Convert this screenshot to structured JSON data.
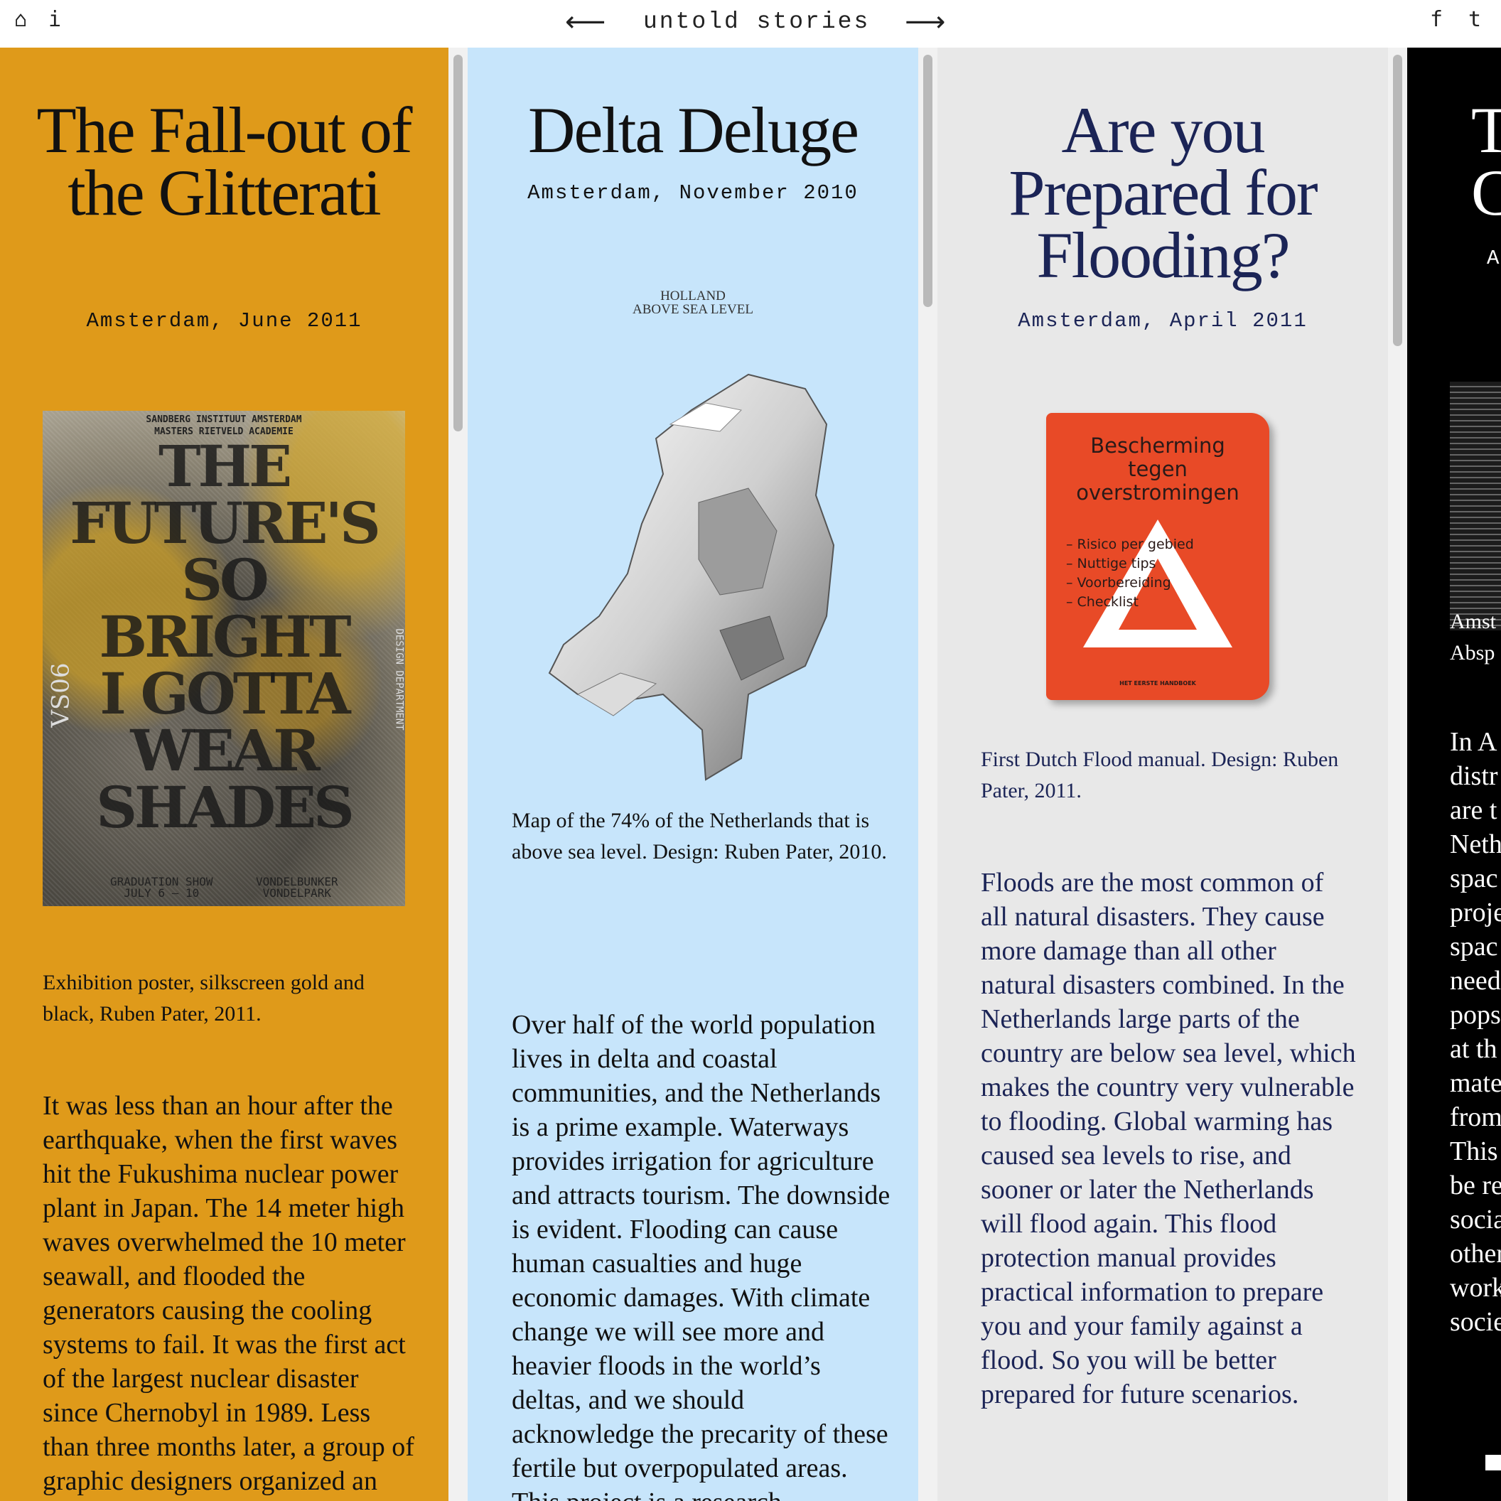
{
  "nav": {
    "home_icon": "⌂",
    "info_icon": "i",
    "prev_arrow": "⟵",
    "title": "untold stories",
    "next_arrow": "⟶",
    "facebook_icon": "f",
    "twitter_icon": "t"
  },
  "stories": [
    {
      "title": "The Fall-out of the Glitterati",
      "place": "Amsterdam, June 2011",
      "poster": {
        "header": [
          "SANDBERG INSTITUUT AMSTERDAM",
          "MASTERS RIETVELD ACADEMIE"
        ],
        "headline": [
          "THE",
          "FUTURE'S",
          "SO",
          "BRIGHT",
          "I GOTTA",
          "WEAR",
          "SHADES"
        ],
        "side_left": "VS06",
        "side_right": "DESIGN DEPARTMENT",
        "footer_left": [
          "GRADUATION SHOW",
          "JULY 6 – 10"
        ],
        "footer_right": [
          "VONDELBUNKER",
          "VONDELPARK"
        ]
      },
      "caption": "Exhibition poster, silkscreen gold and black, Ruben Pater, 2011.",
      "body": "It was less than an hour after the earthquake, when the first waves hit the Fukushima nuclear power plant in Japan. The 14 meter high waves overwhelmed the 10 meter seawall, and flooded the generators causing the cooling systems to fail. It was the first act of the largest nuclear disaster since Chernobyl in 1989. Less than three months later, a group of graphic designers organized an"
    },
    {
      "title": "Delta Deluge",
      "place": "Amsterdam, November 2010",
      "map_label": [
        "HOLLAND",
        "ABOVE SEA LEVEL"
      ],
      "caption": "Map of the 74% of the Netherlands that is above sea level. Design: Ruben Pater, 2010.",
      "body": "Over half of the world population lives in delta and coastal communities, and the Netherlands is a prime example. Waterways provides irrigation for agriculture and attracts tourism. The downside is evident. Flooding can cause human casualties and huge economic damages. With climate change we will see more and heavier floods in the world’s deltas, and we should acknowledge the precarity of these fertile but overpopulated areas. This project is a research"
    },
    {
      "title": "Are you Prepared for Flooding?",
      "place": "Amsterdam, April 2011",
      "manual": {
        "title": [
          "Bescherming",
          "tegen",
          "overstromingen"
        ],
        "items": [
          "– Risico per gebied",
          "– Nuttige tips",
          "– Voorbereiding",
          "– Checklist"
        ],
        "footer": "HET EERSTE HANDBOEK"
      },
      "caption": "First Dutch Flood manual. Design: Ruben Pater, 2011.",
      "body": "Floods are the most common of all natural disasters. They cause more damage than all other natural disasters combined. In the Netherlands large parts of the country are below sea level, which makes the country very vulnerable to flooding. Global warming has caused sea levels to rise, and sooner or later the Netherlands will flood again. This flood protection manual provides practical information to prepare you and your family against a flood. So you will be better prepared for future scenarios."
    },
    {
      "title_partial": [
        "T",
        "C"
      ],
      "place_partial": "A",
      "caption_partial": [
        "Amst",
        "Absp"
      ],
      "body_partial": [
        "In A",
        "distr",
        "are t",
        "Neth",
        "spac",
        "proje",
        "spac",
        "need",
        "pops",
        "at th",
        "mate",
        "from",
        "This",
        "be re",
        "socia",
        "other",
        "work",
        "socie"
      ]
    }
  ],
  "colors": {
    "col1_bg": "#df9a1a",
    "col2_bg": "#c7e5fb",
    "col3_bg": "#e8e8e8",
    "col3_text": "#1b2456",
    "col4_bg": "#000000",
    "manual_red": "#e84a27"
  }
}
